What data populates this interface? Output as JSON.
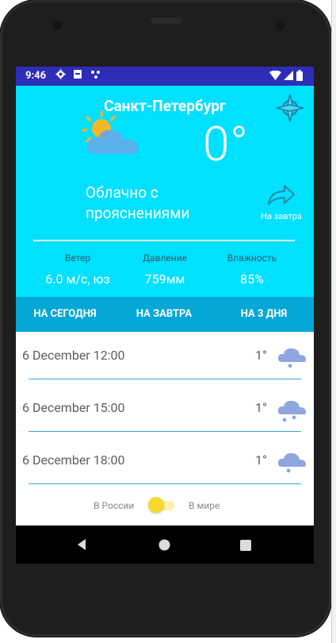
{
  "statusbar": {
    "time": "9:46"
  },
  "header": {
    "city": "Санкт-Петербург",
    "temperature": "0°",
    "description_line1": "Облачно с",
    "description_line2": "прояснениями",
    "tomorrow_link": "На завтра"
  },
  "stats": [
    {
      "label": "Ветер",
      "value": "6.0 м/с, юз"
    },
    {
      "label": "Давление",
      "value": "759мм"
    },
    {
      "label": "Влажность",
      "value": "85%"
    }
  ],
  "tabs": [
    "НА СЕГОДНЯ",
    "НА ЗАВТРА",
    "НА 3 ДНЯ"
  ],
  "forecast": [
    {
      "datetime": "6 December 12:00",
      "temp": "1°",
      "icon": "cloud-snow-icon"
    },
    {
      "datetime": "6 December 15:00",
      "temp": "1°",
      "icon": "cloud-snow-icon"
    },
    {
      "datetime": "6 December 18:00",
      "temp": "1°",
      "icon": "cloud-snow-icon"
    }
  ],
  "region_toggle": {
    "left_label": "В России",
    "right_label": "В мире"
  },
  "colors": {
    "statusbar": "#2d2db8",
    "hero_bg": "#00e0ff",
    "tabs_bg": "#04a7d6",
    "separator": "#3fa6d8",
    "toggle": "#f6d92b"
  }
}
